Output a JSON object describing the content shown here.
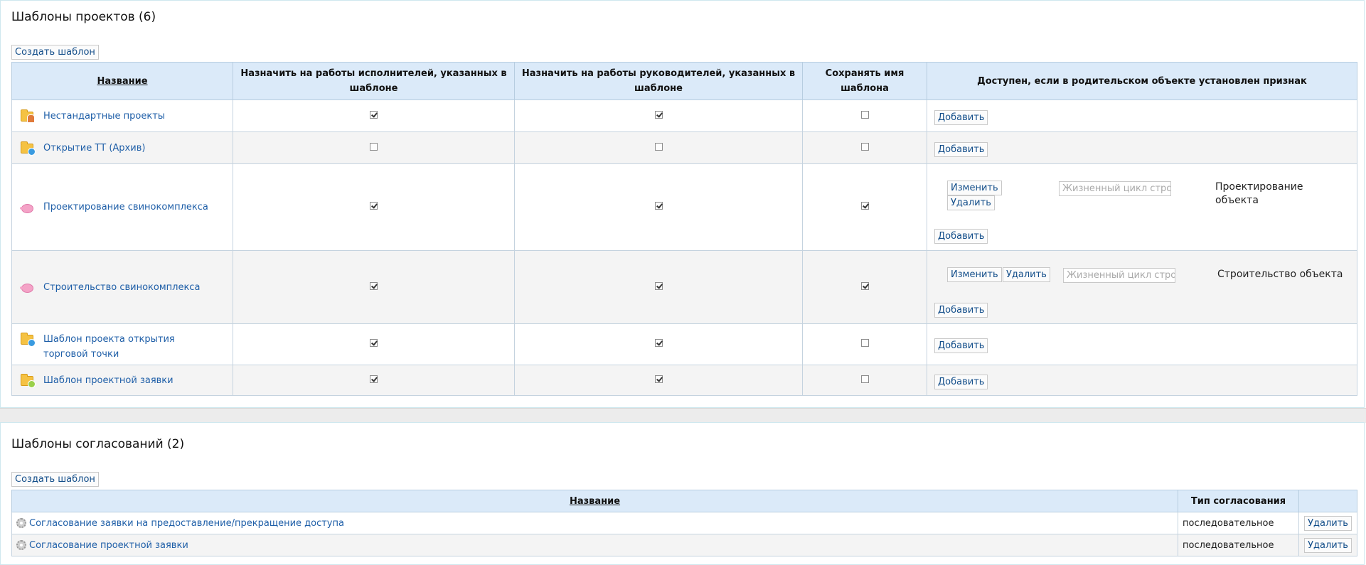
{
  "projects": {
    "title": "Шаблоны проектов (6)",
    "create_label": "Создать шаблон",
    "columns": {
      "name": "Название",
      "assign_executors": "Назначить на работы исполнителей, указанных в шаблоне",
      "assign_managers": "Назначить на работы руководителей, указанных в шаблоне",
      "keep_name": "Сохранять имя шаблона",
      "available_if": "Доступен, если в родительском объекте установлен признак"
    },
    "rows": [
      {
        "name": "Нестандартные проекты",
        "icon": "folder-user-icon",
        "assign_executors": true,
        "assign_managers": true,
        "keep_name": false,
        "add_label": "Добавить"
      },
      {
        "name": "Открытие ТТ (Архив)",
        "icon": "folder-icon",
        "assign_executors": false,
        "assign_managers": false,
        "keep_name": false,
        "add_label": "Добавить"
      },
      {
        "name": "Проектирование свинокомплекса",
        "icon": "pig-icon",
        "assign_executors": true,
        "assign_managers": true,
        "keep_name": true,
        "add_label": "Добавить",
        "sign": {
          "edit_label": "Изменить",
          "delete_label": "Удалить",
          "select_placeholder": "Жизненный цикл строител",
          "value": "Проектирование объекта"
        }
      },
      {
        "name": "Строительство свинокомплекса",
        "icon": "pig-icon",
        "assign_executors": true,
        "assign_managers": true,
        "keep_name": true,
        "add_label": "Добавить",
        "sign": {
          "edit_label": "Изменить",
          "delete_label": "Удалить",
          "select_placeholder": "Жизненный цикл строител",
          "value": "Строительство объекта"
        }
      },
      {
        "name": "Шаблон проекта открытия торговой точки",
        "icon": "folder-icon",
        "assign_executors": true,
        "assign_managers": true,
        "keep_name": false,
        "add_label": "Добавить"
      },
      {
        "name": "Шаблон проектной заявки",
        "icon": "folder-icon",
        "assign_executors": true,
        "assign_managers": true,
        "keep_name": false,
        "add_label": "Добавить"
      }
    ]
  },
  "approvals": {
    "title": "Шаблоны согласований (2)",
    "create_label": "Создать шаблон",
    "columns": {
      "name": "Название",
      "type": "Тип согласования"
    },
    "rows": [
      {
        "name": "Согласование заявки на предоставление/прекращение доступа",
        "type": "последовательное",
        "delete_label": "Удалить"
      },
      {
        "name": "Согласование проектной заявки",
        "type": "последовательное",
        "delete_label": "Удалить"
      }
    ]
  }
}
